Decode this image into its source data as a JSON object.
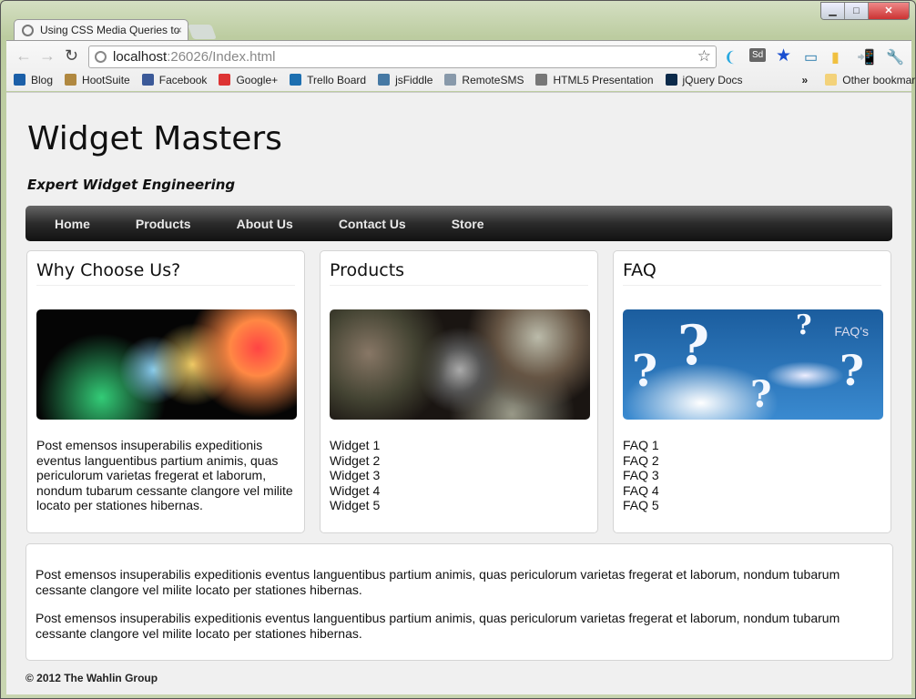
{
  "browser": {
    "tab_title": "Using CSS Media Queries to",
    "url_host": "localhost",
    "url_rest": ":26026/Index.html",
    "bookmarks": [
      {
        "label": "Blog",
        "color": "#1b5fa8"
      },
      {
        "label": "HootSuite",
        "color": "#b08840"
      },
      {
        "label": "Facebook",
        "color": "#3b5998"
      },
      {
        "label": "Google+",
        "color": "#d33"
      },
      {
        "label": "Trello Board",
        "color": "#1d6fb0"
      },
      {
        "label": "jsFiddle",
        "color": "#4679a4"
      },
      {
        "label": "RemoteSMS",
        "color": "#8899aa"
      },
      {
        "label": "HTML5 Presentation",
        "color": "#777"
      },
      {
        "label": "jQuery Docs",
        "color": "#0b2a4a"
      }
    ],
    "overflow": "»",
    "other_bookmarks": "Other bookmarks"
  },
  "site": {
    "title": "Widget Masters",
    "tagline": "Expert Widget Engineering",
    "menu": [
      "Home",
      "Products",
      "About Us",
      "Contact Us",
      "Store"
    ],
    "boxes": [
      {
        "title": "Why Choose Us?",
        "text": "Post emensos insuperabilis expeditionis eventus languentibus partium animis, quas periculorum varietas fregerat et laborum, nondum tubarum cessante clangore vel milite locato per stationes hibernas."
      },
      {
        "title": "Products",
        "items": [
          "Widget 1",
          "Widget 2",
          "Widget 3",
          "Widget 4",
          "Widget 5"
        ]
      },
      {
        "title": "FAQ",
        "image_label": "FAQ's",
        "items": [
          "FAQ 1",
          "FAQ 2",
          "FAQ 3",
          "FAQ 4",
          "FAQ 5"
        ]
      }
    ],
    "paragraphs": [
      "Post emensos insuperabilis expeditionis eventus languentibus partium animis, quas periculorum varietas fregerat et laborum, nondum tubarum cessante clangore vel milite locato per stationes hibernas.",
      "Post emensos insuperabilis expeditionis eventus languentibus partium animis, quas periculorum varietas fregerat et laborum, nondum tubarum cessante clangore vel milite locato per stationes hibernas."
    ],
    "footer": "© 2012 The Wahlin Group"
  }
}
